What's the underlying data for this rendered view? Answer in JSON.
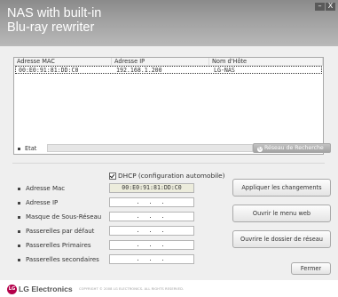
{
  "window": {
    "title_line1": "NAS with built-in",
    "title_line2": "Blu-ray rewriter",
    "minimize_glyph": "–",
    "close_glyph": "X"
  },
  "device_table": {
    "columns": [
      "Adresse MAC",
      "Adresse IP",
      "Nom d'Hôte"
    ],
    "rows": [
      {
        "mac": "00:E0:91:81:DD:C0",
        "ip": "192.168.1.200",
        "hostname": "LG-NAS"
      }
    ]
  },
  "status": {
    "label": "Etat",
    "progress": 0,
    "search_button_label": "Réseau de Recherche",
    "search_icon": "refresh-icon"
  },
  "dhcp": {
    "label": "DHCP (configuration automobile)",
    "checked": true
  },
  "fields": [
    {
      "label": "Adresse Mac",
      "value": "00:E0:91:81:DD:C0"
    },
    {
      "label": "Adresse IP",
      "value": ". . ."
    },
    {
      "label": "Masque de Sous-Réseau",
      "value": ". . ."
    },
    {
      "label": "Passerelles par défaut",
      "value": ". . ."
    },
    {
      "label": "Passerelles Primaires",
      "value": ". . ."
    },
    {
      "label": "Passerelles secondaires",
      "value": ". . ."
    }
  ],
  "actions": {
    "apply": "Appliquer les changements",
    "open_web": "Ouvrir le menu web",
    "open_folder": "Ouvrire le dossier de réseau",
    "close": "Fermer"
  },
  "footer": {
    "logo_text": "LG",
    "brand": "LG Electronics",
    "copyright": "COPYRIGHT © 2008 LG ELECTRONICS. ALL RIGHTS RESERVED."
  },
  "colors": {
    "header_gray": "#9f9f9f",
    "panel_bg": "#efefef",
    "lg_red": "#b4004a"
  }
}
